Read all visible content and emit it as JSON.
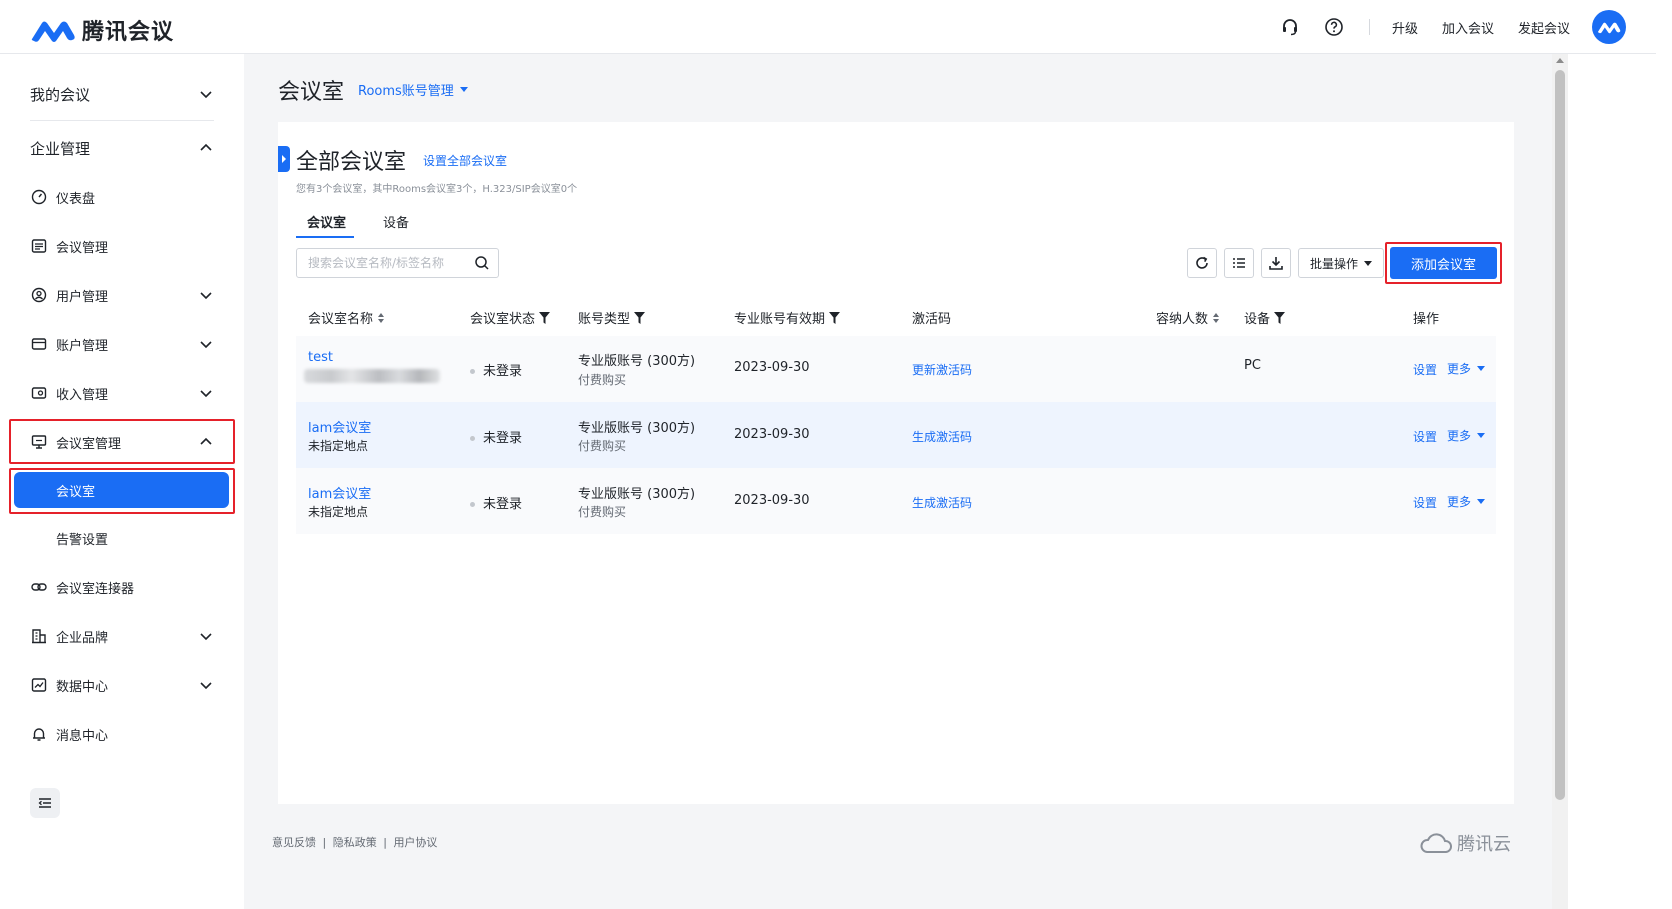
{
  "header": {
    "brand": "腾讯会议",
    "links": [
      "升级",
      "加入会议",
      "发起会议"
    ],
    "accent": "#1a6df4"
  },
  "sidebar": {
    "my_meetings": "我的会议",
    "enterprise": "企业管理",
    "items": [
      {
        "label": "仪表盘",
        "icon": "dashboard-icon"
      },
      {
        "label": "会议管理",
        "icon": "list-icon"
      },
      {
        "label": "用户管理",
        "icon": "user-icon"
      },
      {
        "label": "账户管理",
        "icon": "wallet-icon"
      },
      {
        "label": "收入管理",
        "icon": "income-icon"
      },
      {
        "label": "会议室管理",
        "icon": "monitor-icon"
      },
      {
        "label": "会议室",
        "icon": ""
      },
      {
        "label": "告警设置",
        "icon": ""
      },
      {
        "label": "会议室连接器",
        "icon": "link-icon"
      },
      {
        "label": "企业品牌",
        "icon": "building-icon"
      },
      {
        "label": "数据中心",
        "icon": "chart-icon"
      },
      {
        "label": "消息中心",
        "icon": "bell-icon"
      }
    ]
  },
  "main": {
    "title": "会议室",
    "subnav": "Rooms账号管理",
    "card_title": "全部会议室",
    "card_link": "设置全部会议室",
    "note": "您有3个会议室，其中Rooms会议室3个，H.323/SIP会议室0个",
    "tabs": [
      "会议室",
      "设备"
    ],
    "search_placeholder": "搜索会议室名称/标签名称",
    "batch_label": "批量操作",
    "add_label": "添加会议室"
  },
  "table": {
    "headers": [
      "会议室名称",
      "会议室状态",
      "账号类型",
      "专业账号有效期",
      "激活码",
      "容纳人数",
      "设备",
      "操作"
    ],
    "rows": [
      {
        "name": "test",
        "location": "",
        "status": "未登录",
        "type": "专业版账号 (300方)",
        "purchase": "付费购买",
        "expiry": "2023-09-30",
        "code_action": "更新激活码",
        "capacity": "",
        "device": "PC",
        "action1": "设置",
        "action2": "更多"
      },
      {
        "name": "lam会议室",
        "location": "未指定地点",
        "status": "未登录",
        "type": "专业版账号 (300方)",
        "purchase": "付费购买",
        "expiry": "2023-09-30",
        "code_action": "生成激活码",
        "capacity": "",
        "device": "",
        "action1": "设置",
        "action2": "更多"
      },
      {
        "name": "lam会议室",
        "location": "未指定地点",
        "status": "未登录",
        "type": "专业版账号 (300方)",
        "purchase": "付费购买",
        "expiry": "2023-09-30",
        "code_action": "生成激活码",
        "capacity": "",
        "device": "",
        "action1": "设置",
        "action2": "更多"
      }
    ]
  },
  "footer": {
    "feedback": "意见反馈",
    "privacy": "隐私政策",
    "terms": "用户协议",
    "separator": "|",
    "brand": "腾讯云"
  }
}
